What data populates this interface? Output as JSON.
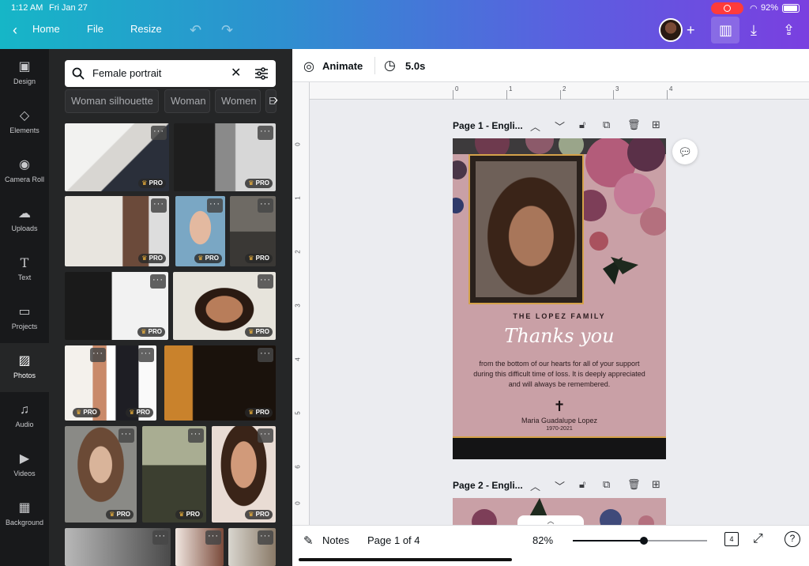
{
  "status_bar": {
    "time": "1:12 AM",
    "date": "Fri Jan 27",
    "battery": "92%"
  },
  "top_bar": {
    "home": "Home",
    "file": "File",
    "resize": "Resize"
  },
  "rail": [
    {
      "label": "Design",
      "icon": "layout-icon"
    },
    {
      "label": "Elements",
      "icon": "shapes-icon"
    },
    {
      "label": "Camera Roll",
      "icon": "camera-icon"
    },
    {
      "label": "Uploads",
      "icon": "cloud-upload-icon"
    },
    {
      "label": "Text",
      "icon": "text-icon"
    },
    {
      "label": "Projects",
      "icon": "folder-icon"
    },
    {
      "label": "Photos",
      "icon": "image-icon",
      "active": true
    },
    {
      "label": "Audio",
      "icon": "music-icon"
    },
    {
      "label": "Videos",
      "icon": "video-icon"
    },
    {
      "label": "Background",
      "icon": "pattern-icon"
    }
  ],
  "search": {
    "value": "Female portrait"
  },
  "chips": [
    "Woman silhouette",
    "Woman",
    "Women",
    "E"
  ],
  "pro_badge": "PRO",
  "editor_toolbar": {
    "animate": "Animate",
    "duration": "5.0s"
  },
  "ruler": {
    "h": [
      "0",
      "1",
      "2",
      "3",
      "4"
    ],
    "v": [
      "0",
      "1",
      "2",
      "3",
      "4",
      "5",
      "6",
      "0"
    ]
  },
  "pages": [
    {
      "title": "Page 1 - Engli..."
    },
    {
      "title": "Page 2 - Engli..."
    }
  ],
  "card": {
    "family": "THE LOPEZ FAMILY",
    "thanks": "Thanks you",
    "body": "from the bottom of our hearts for all of your support during this difficult time of loss. It is deeply appreciated and will always be remembered.",
    "cross": "✝",
    "name": "Maria Guadalupe Lopez",
    "years": "1970-2021",
    "colors": {
      "background": "#c9a0a6",
      "gold": "#d4a24a",
      "band": "#141415"
    }
  },
  "bottom_bar": {
    "notes": "Notes",
    "page_indicator": "Page 1 of 4",
    "zoom": "82%",
    "zoom_level": 0.53,
    "page_count": "4"
  }
}
